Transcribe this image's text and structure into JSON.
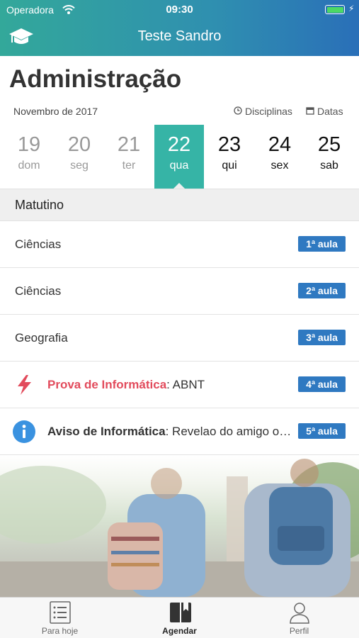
{
  "status_bar": {
    "carrier": "Operadora",
    "time": "09:30"
  },
  "header": {
    "title": "Teste Sandro",
    "logo_icon": "graduation-cap-icon"
  },
  "page": {
    "title": "Administração",
    "month_label": "Novembro de 2017"
  },
  "filters": {
    "disciplinas": "Disciplinas",
    "datas": "Datas"
  },
  "days": [
    {
      "num": "19",
      "weekday": "dom"
    },
    {
      "num": "20",
      "weekday": "seg"
    },
    {
      "num": "21",
      "weekday": "ter"
    },
    {
      "num": "22",
      "weekday": "qua"
    },
    {
      "num": "23",
      "weekday": "qui"
    },
    {
      "num": "24",
      "weekday": "sex"
    },
    {
      "num": "25",
      "weekday": "sab"
    }
  ],
  "selected_day": "22",
  "section": {
    "title": "Matutino"
  },
  "rows": [
    {
      "subject": "Ciências",
      "badge": "1ª aula"
    },
    {
      "subject": "Ciências",
      "badge": "2ª aula"
    },
    {
      "subject": "Geografia",
      "badge": "3ª aula"
    },
    {
      "label": "Prova de Informática",
      "text": ": ABNT",
      "badge": "4ª aula",
      "icon": "lightning-icon"
    },
    {
      "label": "Aviso de Informática",
      "text": ": Revelao do amigo oculto",
      "badge": "5ª aula",
      "icon": "info-icon"
    }
  ],
  "tabs": [
    {
      "label": "Para hoje",
      "icon": "list-icon"
    },
    {
      "label": "Agendar",
      "icon": "book-icon"
    },
    {
      "label": "Perfil",
      "icon": "user-icon"
    }
  ],
  "active_tab": "Agendar",
  "colors": {
    "header_start": "#33a89a",
    "header_end": "#2a6fb8",
    "selected_day": "#36b4a6",
    "badge": "#2f79c1",
    "alert": "#e24b5c",
    "info": "#3a92e0"
  }
}
